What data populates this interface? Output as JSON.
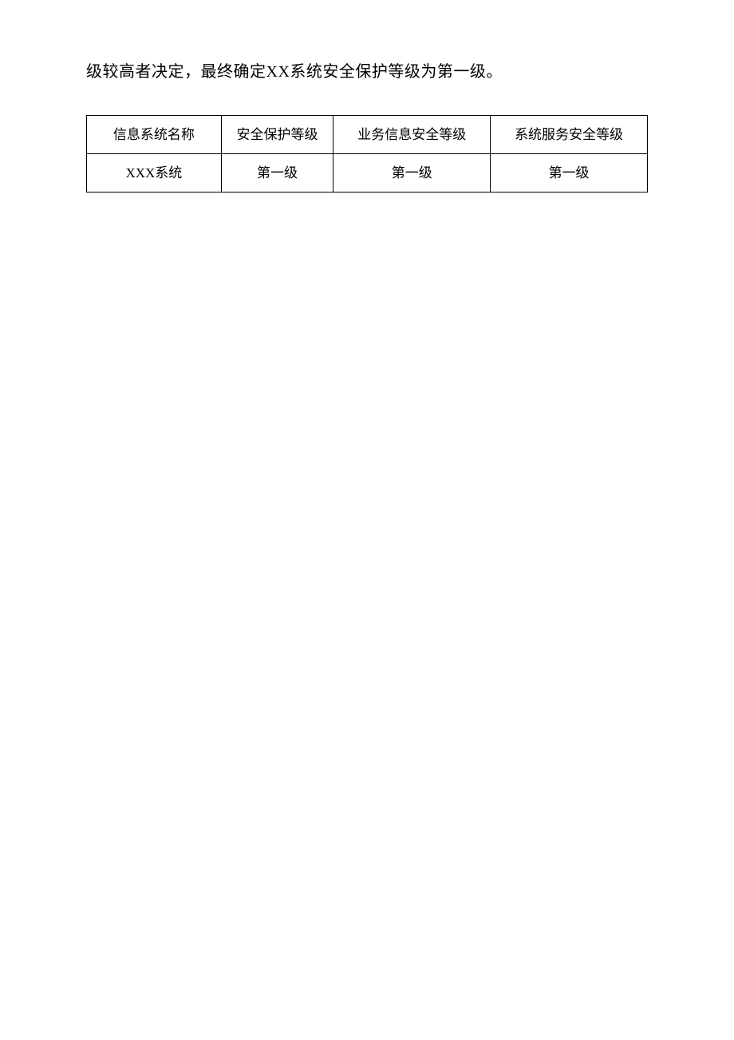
{
  "paragraph_text": "级较高者决定，最终确定XX系统安全保护等级为第一级。",
  "table": {
    "headers": [
      "信息系统名称",
      "安全保护等级",
      "业务信息安全等级",
      "系统服务安全等级"
    ],
    "rows": [
      {
        "system_name": "XXX系统",
        "protection_level": "第一级",
        "business_info_level": "第一级",
        "service_level": "第一级"
      }
    ]
  }
}
